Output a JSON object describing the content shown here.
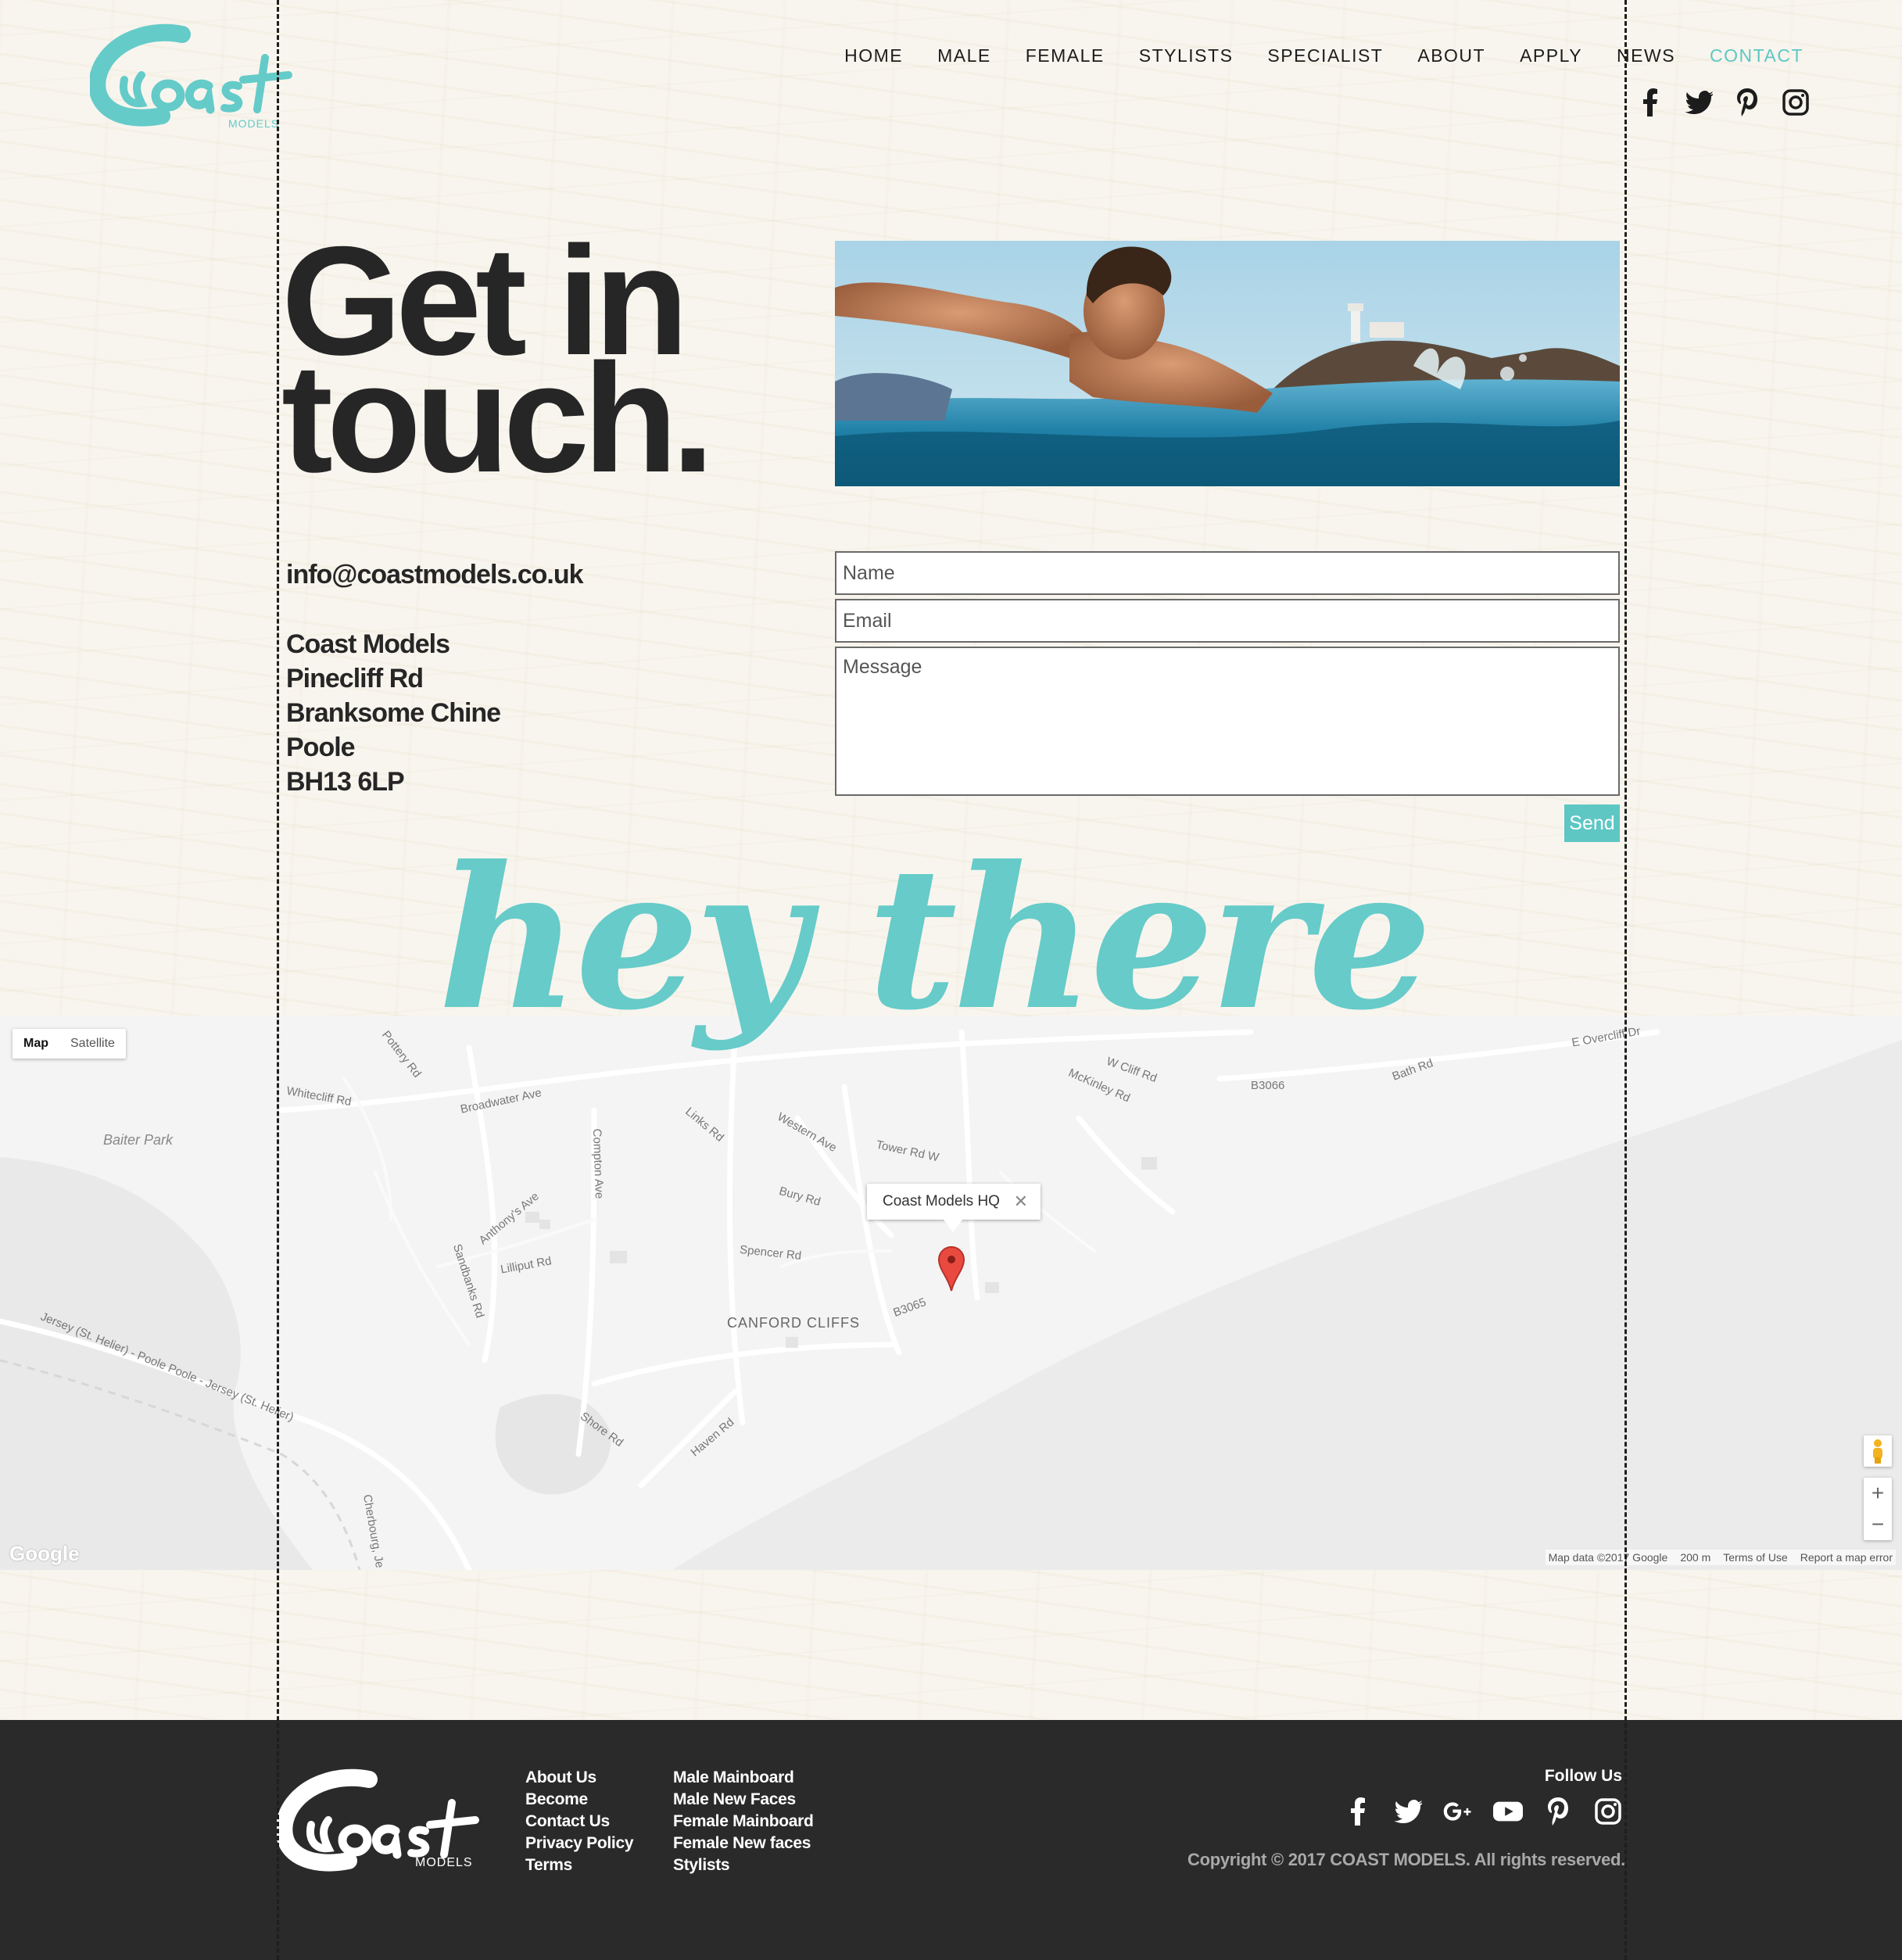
{
  "brand": {
    "logo_word": "Coast",
    "logo_sub": "MODELS",
    "accent": "#5ec7c4"
  },
  "nav": {
    "items": [
      {
        "label": "HOME"
      },
      {
        "label": "MALE"
      },
      {
        "label": "FEMALE"
      },
      {
        "label": "STYLISTS"
      },
      {
        "label": "SPECIALIST"
      },
      {
        "label": "ABOUT"
      },
      {
        "label": "APPLY"
      },
      {
        "label": "NEWS"
      },
      {
        "label": "CONTACT",
        "active": true
      }
    ],
    "social_icons": [
      "facebook-icon",
      "twitter-icon",
      "pinterest-icon",
      "instagram-icon"
    ]
  },
  "hero": {
    "headline_line1": "Get in",
    "headline_line2": "touch."
  },
  "contact": {
    "email": "info@coastmodels.co.uk",
    "address": [
      "Coast Models",
      "Pinecliff Rd",
      "Branksome Chine",
      "Poole",
      "BH13 6LP"
    ]
  },
  "form": {
    "name_placeholder": "Name",
    "email_placeholder": "Email",
    "message_placeholder": "Message",
    "send_label": "Send"
  },
  "script_overlay": "hey there",
  "map": {
    "type_map": "Map",
    "type_satellite": "Satellite",
    "marker_title": "Coast Models HQ",
    "place_labels": {
      "baiter_park": "Baiter Park",
      "canford_cliffs": "CANFORD CLIFFS",
      "broadwater": "Broadwater Ave",
      "compton": "Compton Ave",
      "lilliput": "Lilliput Rd",
      "sandbanks": "Sandbanks Rd",
      "anthonys": "Anthony's Ave",
      "bury": "Bury Rd",
      "spencer": "Spencer Rd",
      "tower_w": "Tower Rd W",
      "links": "Links Rd",
      "western": "Western Ave",
      "b3065": "B3065",
      "b3066": "B3066",
      "bath": "Bath Rd",
      "shore": "Shore Rd",
      "haven": "Haven Rd",
      "whitecliff": "Whitecliff Rd",
      "pottery": "Pottery Rd",
      "mckinley": "McKinley Rd",
      "w_cliff": "W Cliff Rd",
      "ferry": "Jersey (St. Helier) - Poole  Poole - Jersey (St. Helier)",
      "cherbourg": "Cherbourg, Je",
      "e_overcliff": "E Overcliff Dr"
    },
    "google_label": "Google",
    "attribution": "Map data ©2017 Google",
    "scale": "200 m",
    "terms": "Terms of Use",
    "report": "Report a map error",
    "zoom_in": "+",
    "zoom_out": "−"
  },
  "footer": {
    "col1": [
      "About Us",
      "Become",
      "Contact Us",
      "Privacy Policy",
      "Terms"
    ],
    "col2": [
      "Male Mainboard",
      "Male New Faces",
      "Female Mainboard",
      "Female New faces",
      "Stylists"
    ],
    "follow_label": "Follow Us",
    "social_icons": [
      "facebook-icon",
      "twitter-icon",
      "google-plus-icon",
      "youtube-icon",
      "pinterest-icon",
      "instagram-icon"
    ],
    "copyright": "Copyright © 2017 COAST MODELS. All rights reserved."
  }
}
